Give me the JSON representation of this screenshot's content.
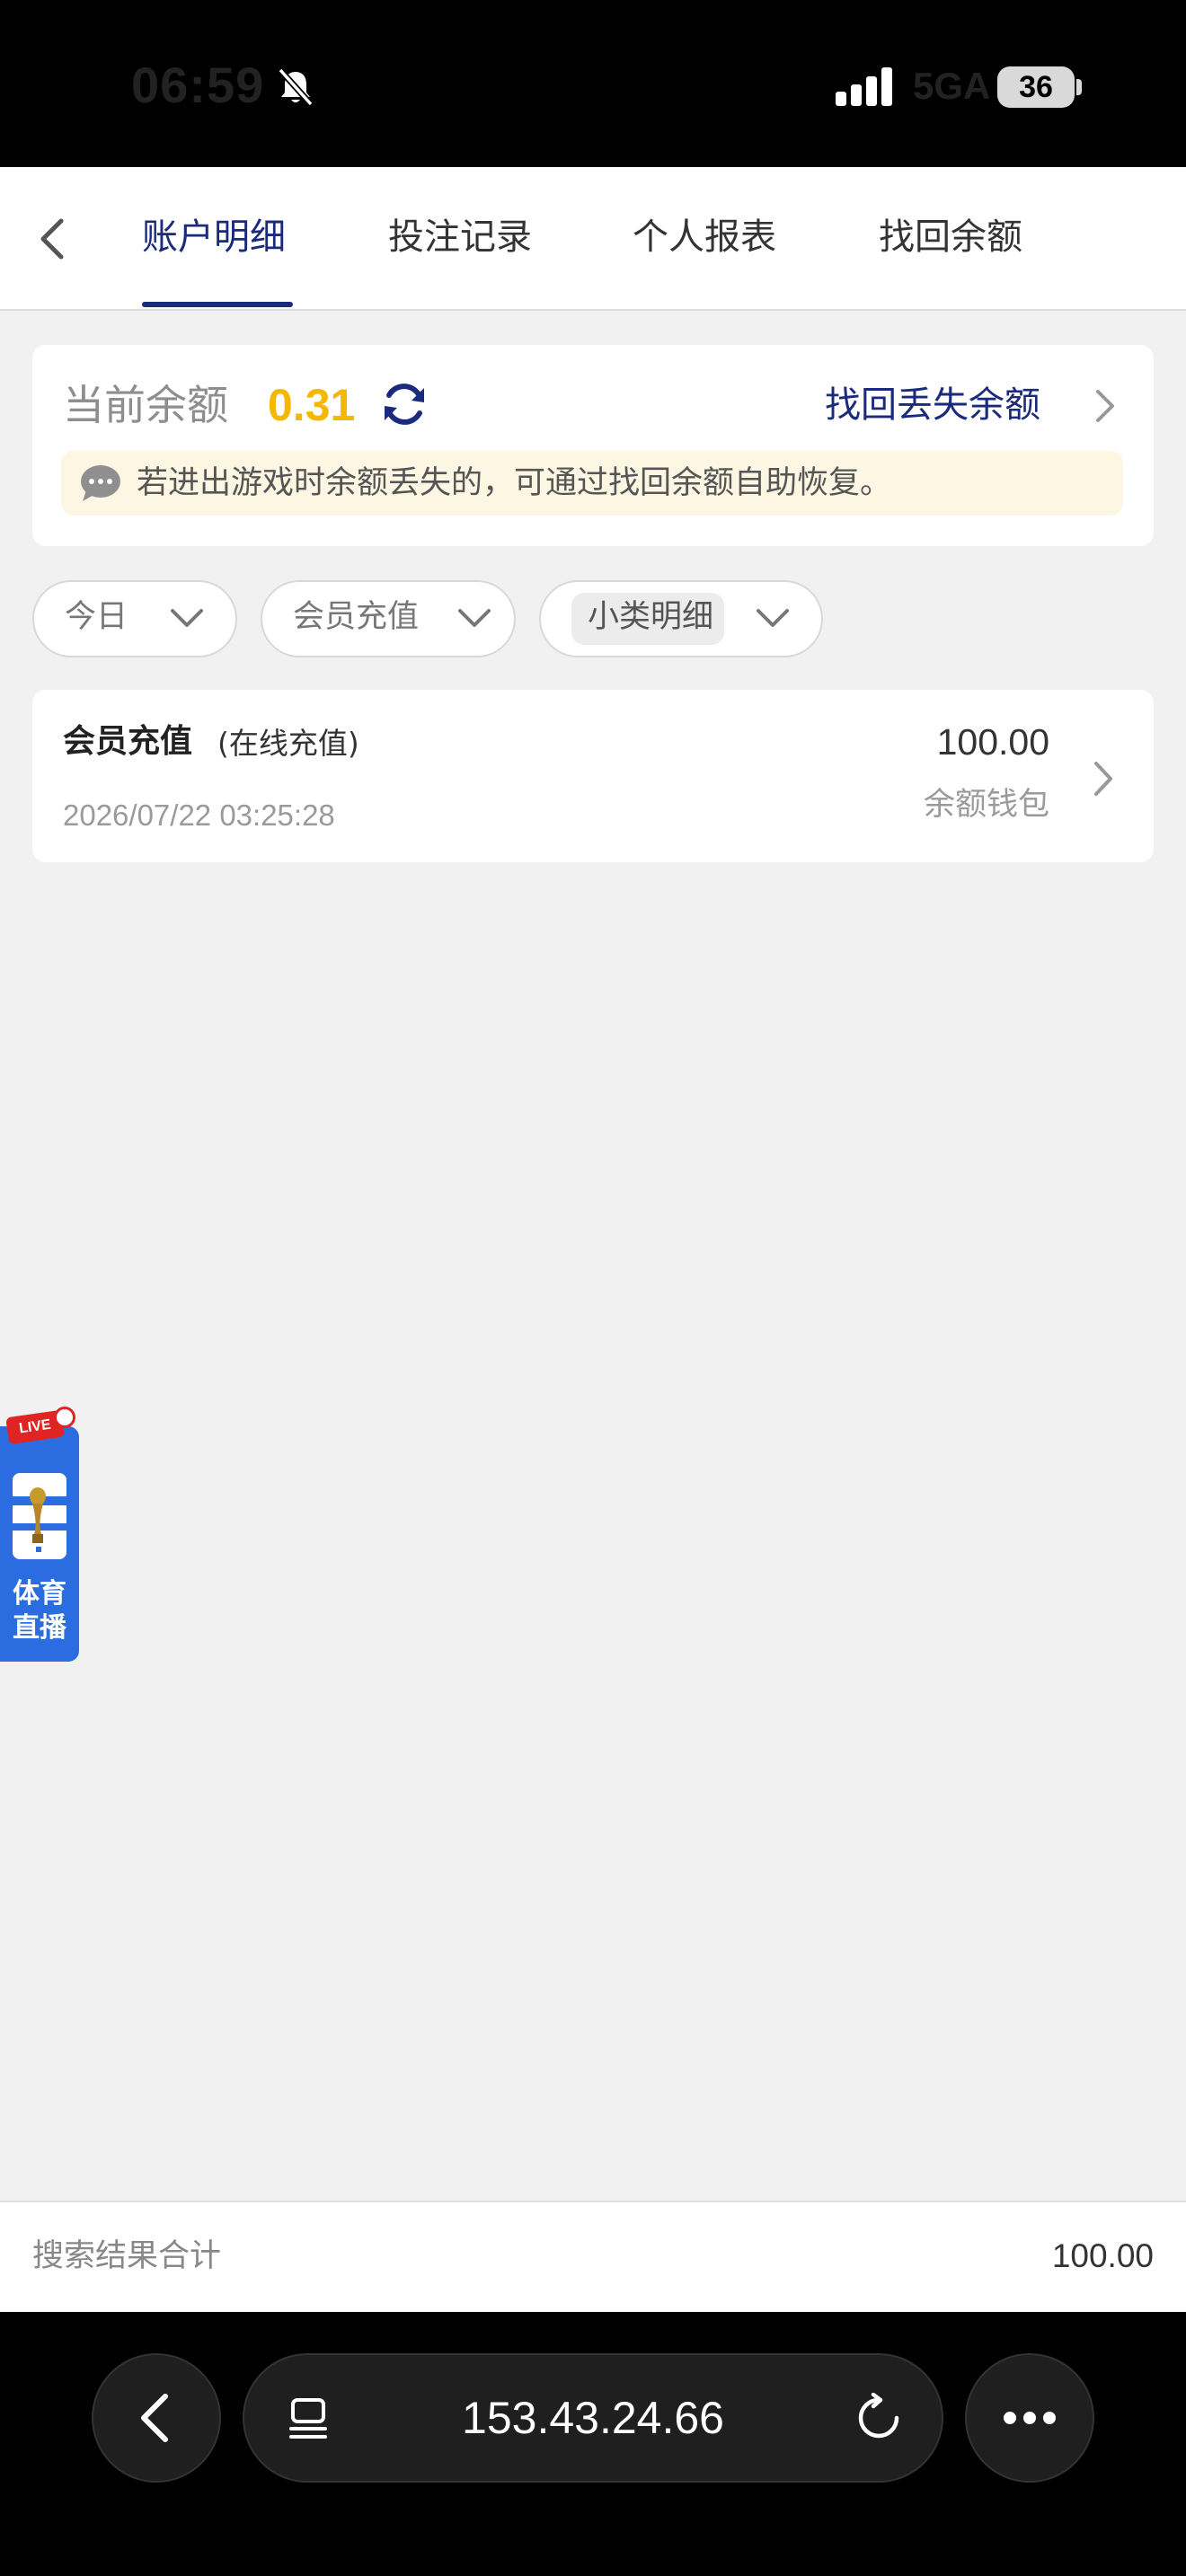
{
  "status_bar": {
    "time": "06:59",
    "network": "5GA",
    "battery": "36"
  },
  "tabs": [
    {
      "label": "账户明细"
    },
    {
      "label": "投注记录"
    },
    {
      "label": "个人报表"
    },
    {
      "label": "找回余额"
    }
  ],
  "balance": {
    "label": "当前余额",
    "value": "0.31",
    "recover_link": "找回丢失余额",
    "notice": "若进出游戏时余额丢失的，可通过找回余额自助恢复。"
  },
  "filters": {
    "date": "今日",
    "type": "会员充值",
    "subtype": "小类明细"
  },
  "records": [
    {
      "title": "会员充值",
      "subtitle": "(在线充值)",
      "time": "2026/07/22 03:25:28",
      "amount": "100.00",
      "wallet": "余额钱包"
    }
  ],
  "live_badge": {
    "tag": "LIVE",
    "label": "体育\n直播"
  },
  "total": {
    "label": "搜索结果合计",
    "value": "100.00"
  },
  "browser": {
    "address": "153.43.24.66"
  },
  "colors": {
    "accent": "#1a2a7c",
    "balance": "#f5b800",
    "notice_bg": "#fdf6e3",
    "live_badge": "#2b6de0"
  },
  "icons": {
    "back": "chevron-left-icon",
    "refresh": "refresh-icon",
    "chat": "chat-bubble-icon",
    "dropdown": "chevron-down-icon",
    "forward": "chevron-right-icon",
    "trophy": "trophy-icon",
    "tabs": "tabs-icon",
    "reload": "reload-icon",
    "more": "more-icon"
  }
}
